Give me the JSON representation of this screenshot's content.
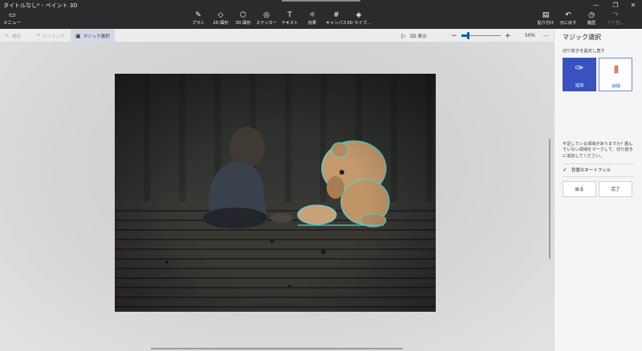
{
  "window": {
    "title": "タイトルなし* - ペイント 3D",
    "controls": [
      "—",
      "❐",
      "✕"
    ]
  },
  "menu": {
    "icon": "menu-folder-icon",
    "label": "メニュー"
  },
  "tools": [
    {
      "label": "ブラシ",
      "icon": "brush-icon"
    },
    {
      "label": "2D 図形",
      "icon": "2d-shapes-icon"
    },
    {
      "label": "3D 図形",
      "icon": "3d-shapes-icon"
    },
    {
      "label": "ステッカー",
      "icon": "sticker-icon"
    },
    {
      "label": "テキスト",
      "icon": "text-icon"
    },
    {
      "label": "効果",
      "icon": "effects-icon"
    },
    {
      "label": "キャンバス",
      "icon": "canvas-icon"
    },
    {
      "label": "3D ライブ...",
      "icon": "3d-library-icon"
    }
  ],
  "right_tools": [
    {
      "label": "貼り付け",
      "icon": "paste-icon"
    },
    {
      "label": "元に戻す",
      "icon": "undo-icon"
    },
    {
      "label": "履歴",
      "icon": "history-icon"
    },
    {
      "label": "やり直し",
      "icon": "redo-icon"
    }
  ],
  "subbar": {
    "select_label": "選択",
    "trim_label": "トリミング",
    "magic_select_label": "マジック選択",
    "view3d_label": "3D 表示",
    "zoom_minus": "−",
    "zoom_plus": "+",
    "zoom_value": "50%",
    "more": "···"
  },
  "zoom_level_fraction": 0.15,
  "panel": {
    "title": "マジック選択",
    "subtitle": "切り抜きを設定し直す",
    "add_label": "追加",
    "remove_label": "削除",
    "help_text": "不足している領域がありますか? 選んでいない領域をマークして、切り抜きに追加してください。",
    "autofill_label": "背景のオートフィル",
    "back_label": "戻る",
    "done_label": "完了"
  },
  "colors": {
    "accent": "#0063b1",
    "add_button": "#3a52c0",
    "titlebar": "#2b2b2b"
  }
}
